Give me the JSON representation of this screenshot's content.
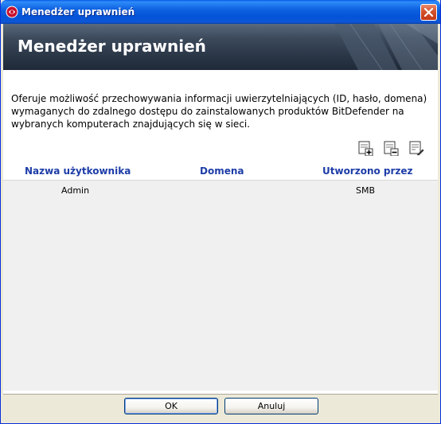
{
  "window": {
    "title": "Menedżer uprawnień",
    "close_icon": "close-icon",
    "app_icon": "bitdefender-logo-icon"
  },
  "banner": {
    "title": "Menedżer uprawnień"
  },
  "description": "Oferuje możliwość przechowywania informacji uwierzytelniających (ID, hasło, domena) wymaganych do zdalnego dostępu do zainstalowanych produktów BitDefender na wybranych komputerach znajdujących się w sieci.",
  "toolbar": {
    "icons": [
      "add-credential-icon",
      "remove-credential-icon",
      "edit-credential-icon"
    ]
  },
  "table": {
    "columns": [
      "Nazwa użytkownika",
      "Domena",
      "Utworzono przez"
    ],
    "rows": [
      [
        "Admin",
        "",
        "SMB"
      ]
    ]
  },
  "buttons": {
    "ok": "OK",
    "cancel": "Anuluj"
  },
  "colors": {
    "header_text": "#1E3DA8",
    "titlebar": "#0453D8"
  }
}
